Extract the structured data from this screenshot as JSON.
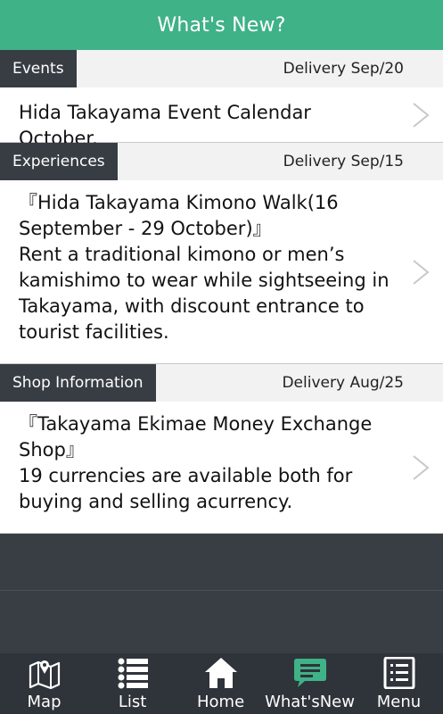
{
  "header": {
    "title": "What's New?"
  },
  "news": [
    {
      "category": "Events",
      "delivery": "Delivery Sep/20",
      "text": "Hida Takayama Event Calendar October."
    },
    {
      "category": "Experiences",
      "delivery": "Delivery Sep/15",
      "text": "『Hida Takayama Kimono Walk(16 September - 29 October)』\nRent a traditional kimono or men’s kamishimo to wear while sightseeing in Takayama, with discount entrance to tourist facilities."
    },
    {
      "category": "Shop Information",
      "delivery": "Delivery Aug/25",
      "text": "『Takayama Ekimae Money Exchange Shop』\n19 currencies are available both for buying and selling acurrency."
    }
  ],
  "tabs": [
    {
      "label": "Map",
      "icon": "map-icon"
    },
    {
      "label": "List",
      "icon": "list-icon"
    },
    {
      "label": "Home",
      "icon": "home-icon"
    },
    {
      "label": "What'sNew",
      "icon": "chat-bubble-icon",
      "active": true
    },
    {
      "label": "Menu",
      "icon": "menu-icon"
    }
  ],
  "colors": {
    "header": "#3fb287",
    "category_tag": "#383d44",
    "tabbar": "#2f333a",
    "active_icon": "#3fb287"
  }
}
